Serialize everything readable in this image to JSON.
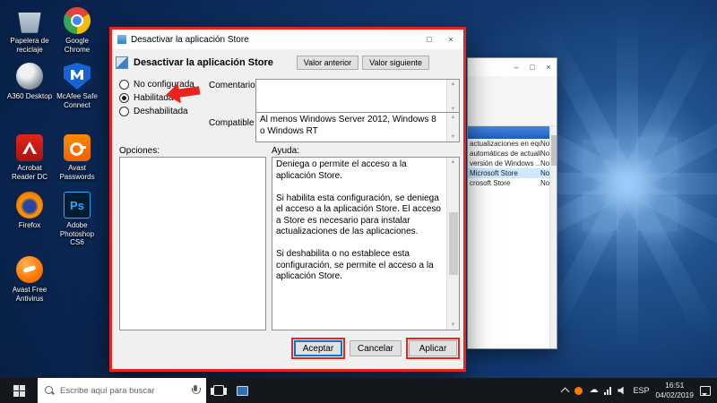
{
  "desktop": {
    "icons": [
      {
        "label": "Papelera de reciclaje"
      },
      {
        "label": "A360 Desktop"
      },
      {
        "label": "Acrobat Reader DC"
      },
      {
        "label": "Firefox"
      },
      {
        "label": "Avast Free Antivirus"
      },
      {
        "label": "Google Chrome"
      },
      {
        "label": "McAfee Safe Connect"
      },
      {
        "label": "Avast Passwords"
      },
      {
        "label": "Adobe Photoshop CS6",
        "glyph": "Ps"
      }
    ]
  },
  "dialog": {
    "title": "Desactivar la aplicación Store",
    "setting_name": "Desactivar la aplicación Store",
    "prev_button": "Valor anterior",
    "next_button": "Valor siguiente",
    "radio_not_configured": "No configurada",
    "radio_enabled": "Habilitada",
    "radio_disabled": "Deshabilitada",
    "comment_label": "Comentario:",
    "supported_label": "Compatible con:",
    "supported_value": "Al menos Windows Server 2012, Windows 8 o Windows RT",
    "options_label": "Opciones:",
    "help_label": "Ayuda:",
    "help_text": "Deniega o permite el acceso a la aplicación Store.\n\nSi habilita esta configuración, se deniega el acceso a la aplicación Store. El acceso a Store es necesario para instalar actualizaciones de las aplicaciones.\n\nSi deshabilita o no establece esta configuración, se permite el acceso a la aplicación Store.",
    "ok_button": "Aceptar",
    "cancel_button": "Cancelar",
    "apply_button": "Aplicar",
    "controls": {
      "maximize": "□",
      "close": "×"
    },
    "accent_red": "#e8241d"
  },
  "background_window": {
    "controls": {
      "minimize": "–",
      "maximize": "□",
      "close": "×"
    },
    "rows": [
      {
        "label": "actualizaciones en equ...",
        "status": "No"
      },
      {
        "label": "automáticas de actualiz...",
        "status": "No"
      },
      {
        "label": "versión de Windows ...",
        "status": "No"
      },
      {
        "label": "Microsoft Store",
        "status": "No"
      },
      {
        "label": "crosoft Store",
        "status": "No"
      }
    ]
  },
  "taskbar": {
    "search_placeholder": "Escribe aquí para buscar",
    "language": "ESP",
    "time": "16:51",
    "date": "04/02/2019"
  },
  "glyphs": {
    "scroll_up": "▲",
    "scroll_down": "▼",
    "cloud": "☁"
  }
}
